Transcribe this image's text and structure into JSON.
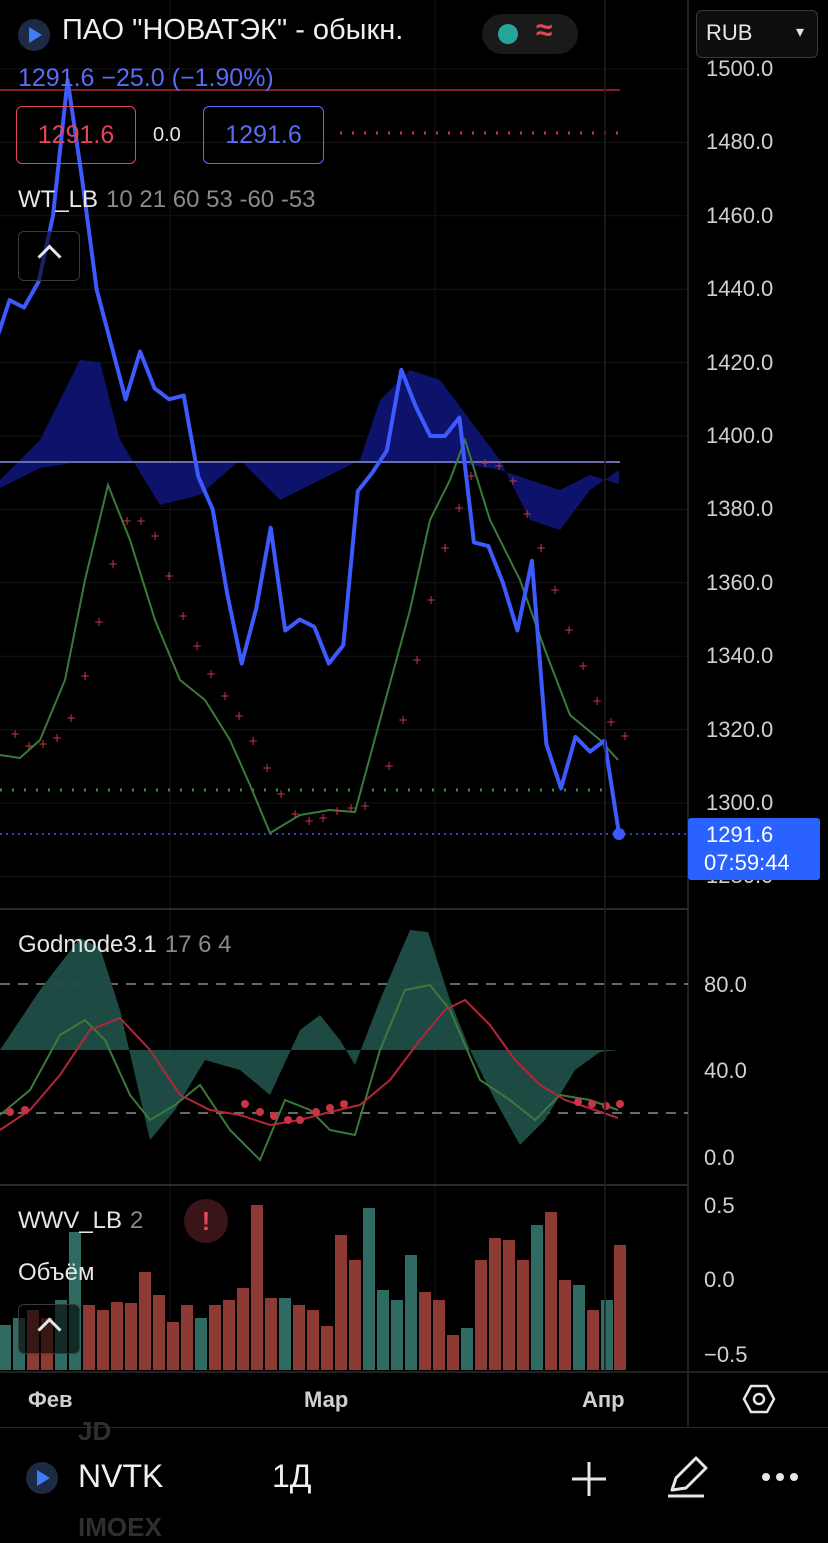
{
  "header": {
    "title": "ПАО \"НОВАТЭК\" - обыкн.",
    "currency": "RUB",
    "quote": "1291.6  −25.0 (−1.90%)",
    "sell_price": "1291.6",
    "spread": "0.0",
    "buy_price": "1291.6",
    "status_icon": "market-open-dot",
    "wave_icon": "tilde-wave-icon"
  },
  "indicators": {
    "wt": {
      "name": "WT_LB",
      "params": "10 21 60 53 -60 -53"
    },
    "godmode": {
      "name": "Godmode3.1",
      "params": "17 6 4"
    },
    "wwv": {
      "name": "WWV_LB",
      "params": "2"
    },
    "volume": {
      "name": "Объём"
    }
  },
  "price_axis": [
    "1500.0",
    "1480.0",
    "1460.0",
    "1440.0",
    "1420.0",
    "1400.0",
    "1380.0",
    "1360.0",
    "1340.0",
    "1320.0",
    "1300.0",
    "1280.0"
  ],
  "last_price": {
    "price": "1291.6",
    "countdown": "07:59:44"
  },
  "godmode_axis": [
    "80.0",
    "40.0",
    "0.0"
  ],
  "wwv_axis": [
    "0.5",
    "0.0",
    "−0.5"
  ],
  "time_axis": [
    "Фев",
    "Мар",
    "Апр"
  ],
  "bottom_bar": {
    "ticker": "NVTK",
    "interval": "1Д",
    "ghost_exchange_1": "JD",
    "ghost_exchange_2": "IMOEX"
  },
  "colors": {
    "price_line": "#3d5afe",
    "red": "#e0455a",
    "green": "#3a7a3a",
    "cloud": "#0e1370",
    "teal_fill": "#1f4f48",
    "bar_green": "#2f6b63",
    "bar_red": "#8e3a34"
  },
  "chart_data": {
    "type": "line",
    "series": [
      {
        "values": [
          1425,
          1437,
          1435,
          1442,
          1460,
          1497,
          1470,
          1440,
          1425,
          1410,
          1423,
          1413,
          1410,
          1411,
          1389,
          1380,
          1357,
          1338,
          1353,
          1375,
          1347,
          1350,
          1348,
          1338,
          1343,
          1385,
          1390,
          1396,
          1418,
          1408,
          1400,
          1400,
          1405,
          1371,
          1370,
          1360,
          1347,
          1366,
          1316,
          1304,
          1318,
          1314,
          1317,
          1291.6
        ]
      }
    ],
    "ylim": [
      1280,
      1500
    ]
  }
}
